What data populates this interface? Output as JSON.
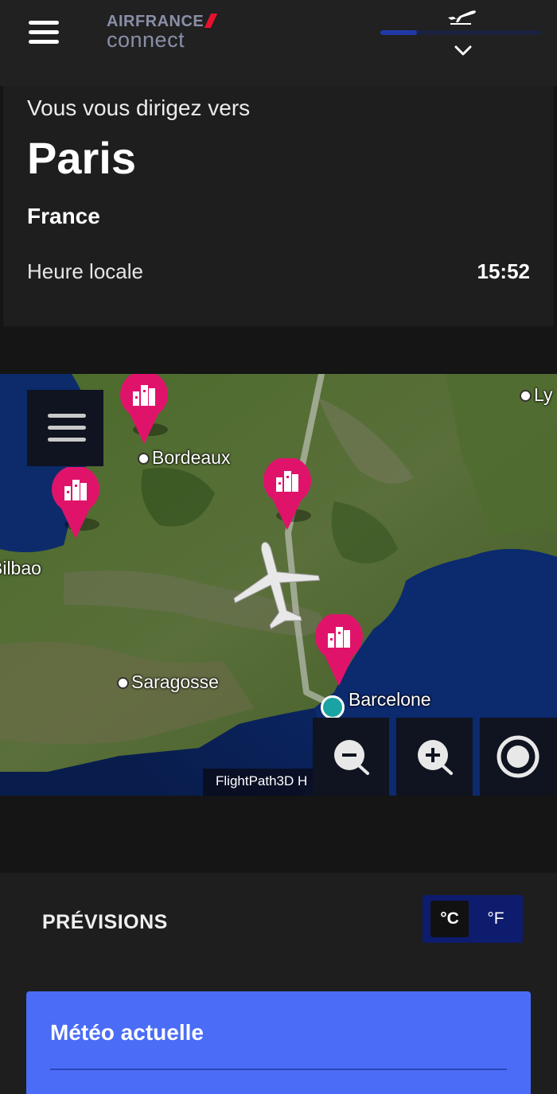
{
  "header": {
    "logo_top": "AIRFRANCE",
    "logo_bottom": "connect",
    "flight_progress": 0.23
  },
  "destination": {
    "subtitle": "Vous vous dirigez vers",
    "city": "Paris",
    "country": "France",
    "local_time_label": "Heure locale",
    "local_time": "15:52"
  },
  "map": {
    "cities": {
      "bordeaux": "Bordeaux",
      "bilbao": "Bilbao",
      "saragosse": "Saragosse",
      "barcelone": "Barcelone",
      "lyon": "Ly"
    },
    "credit": "FlightPath3D H",
    "pin_color": "#e0136b",
    "current_position_color": "#1aa3a3"
  },
  "forecast": {
    "title": "PRÉVISIONS",
    "unit_celsius": "°C",
    "unit_fahrenheit": "°F",
    "selected_unit": "°C",
    "current_weather_title": "Météo actuelle",
    "card_color": "#4a6cf7"
  }
}
